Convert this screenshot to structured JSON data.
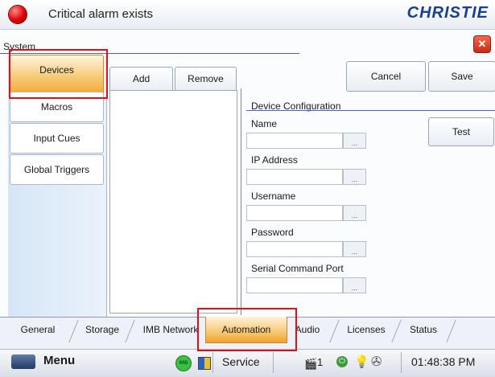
{
  "header": {
    "alarm_text": "Critical alarm exists",
    "logo": "CHRISTIE",
    "alarm_color": "#e00000"
  },
  "system": {
    "label": "System"
  },
  "left_tabs": [
    {
      "label": "Devices",
      "active": true
    },
    {
      "label": "Macros",
      "active": false
    },
    {
      "label": "Input Cues",
      "active": false
    },
    {
      "label": "Global Triggers",
      "active": false
    }
  ],
  "toolbar": {
    "add": "Add",
    "remove": "Remove",
    "cancel": "Cancel",
    "save": "Save",
    "test": "Test"
  },
  "config": {
    "title": "Device Configuration",
    "fields": [
      {
        "label": "Name",
        "value": "",
        "button": "..."
      },
      {
        "label": "IP Address",
        "value": "",
        "button": "..."
      },
      {
        "label": "Username",
        "value": "",
        "button": "..."
      },
      {
        "label": "Password",
        "value": "",
        "button": "..."
      },
      {
        "label": "Serial Command Port",
        "value": "",
        "button": "..."
      }
    ]
  },
  "bottom_tabs": [
    {
      "label": "General",
      "active": false
    },
    {
      "label": "Storage",
      "active": false
    },
    {
      "label": "IMB Network",
      "active": false
    },
    {
      "label": "Automation",
      "active": true
    },
    {
      "label": "Audio",
      "active": false
    },
    {
      "label": "Licenses",
      "active": false
    },
    {
      "label": "Status",
      "active": false
    }
  ],
  "statusbar": {
    "menu": "Menu",
    "imb_badge": "IMB",
    "service": "Service",
    "camera_count": "1",
    "time": "01:48:38 PM"
  },
  "colors": {
    "accent_active": "#f2a833",
    "highlight": "#e0101a",
    "brand": "#1b3f8f"
  }
}
